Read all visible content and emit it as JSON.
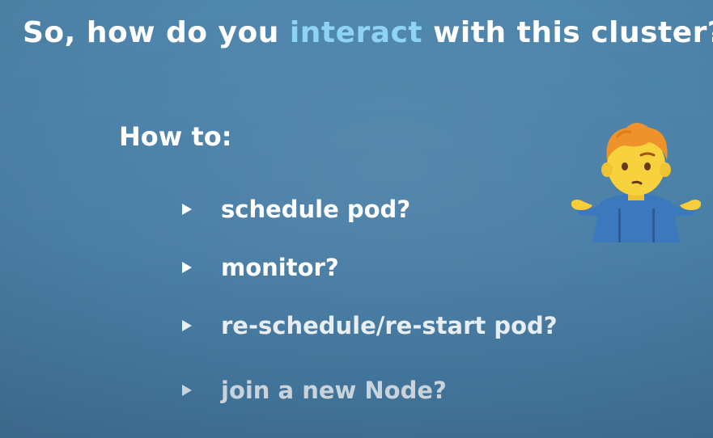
{
  "slide": {
    "title_before": "So, how do you ",
    "title_accent": "interact",
    "title_after": " with this cluster?",
    "subtitle": "How to:",
    "bullets": [
      "schedule pod?",
      "monitor?",
      "re-schedule/re-start pod?",
      "join a new Node?"
    ],
    "emoji_icon": "person-shrugging-icon"
  },
  "colors": {
    "background": "#4f86ad",
    "text": "#ffffff",
    "accent": "#8fd3f2"
  }
}
